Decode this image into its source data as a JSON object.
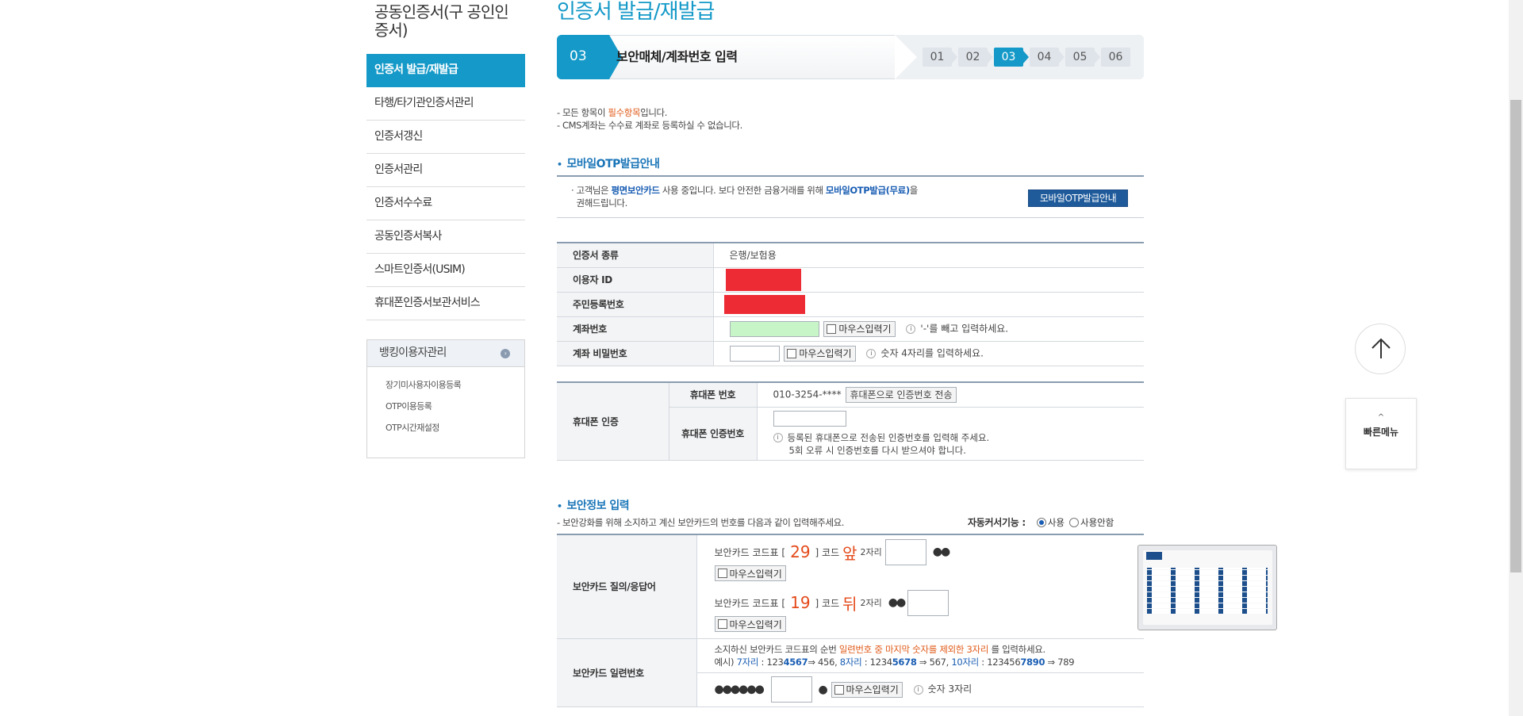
{
  "sidebar": {
    "title": "공동인증서(구 공인인증서)",
    "items": [
      {
        "label": "인증서 발급/재발급",
        "active": true
      },
      {
        "label": "타행/타기관인증서관리"
      },
      {
        "label": "인증서갱신"
      },
      {
        "label": "인증서관리"
      },
      {
        "label": "인증서수수료"
      },
      {
        "label": "공동인증서복사"
      },
      {
        "label": "스마트인증서(USIM)"
      },
      {
        "label": "휴대폰인증서보관서비스"
      }
    ],
    "banking_box": {
      "title": "뱅킹이용자관리",
      "items": [
        "장기미사용자이용등록",
        "OTP이용등록",
        "OTP시간재설정"
      ]
    }
  },
  "main": {
    "page_title": "인증서 발급/재발급",
    "step": {
      "current_num": "03",
      "current_name": "보안매체/계좌번호 입력",
      "steps": [
        "01",
        "02",
        "03",
        "04",
        "05",
        "06"
      ],
      "active_index": 2
    },
    "notes": {
      "line1_a": "- 모든 항목이 ",
      "line1_hl": "필수항목",
      "line1_b": "입니다.",
      "line2": "- CMS계좌는 수수료 계좌로 등록하실 수 없습니다."
    },
    "otp_section": {
      "title": "모바일OTP발급안내",
      "text_a": "· 고객님은 ",
      "text_b1": "평면보안카드",
      "text_c": " 사용 중입니다. 보다 안전한 금융거래를 위해 ",
      "text_b2": "모바일OTP발급(무료)",
      "text_d": "을",
      "text_e": "권해드립니다.",
      "button": "모바일OTP발급안내"
    },
    "cert_table": {
      "rows": [
        {
          "label": "인증서 종류",
          "value": "은행/보험용"
        },
        {
          "label": "이용자 ID"
        },
        {
          "label": "주민등록번호"
        },
        {
          "label": "계좌번호",
          "hint": "'-'를 빼고 입력하세요."
        },
        {
          "label": "계좌 비밀번호",
          "hint": "숫자 4자리를 입력하세요."
        }
      ],
      "mouse_input": "마우스입력기"
    },
    "phone_table": {
      "label": "휴대폰 인증",
      "phone_label": "휴대폰 번호",
      "phone_value": "010-3254-****",
      "send_button": "휴대폰으로 인증번호 전송",
      "code_label": "휴대폰 인증번호",
      "code_hint1": "등록된 휴대폰으로 전송된 인증번호를 입력해 주세요.",
      "code_hint2": "5회 오류 시 인증번호를 다시 받으셔야 합니다."
    },
    "security_section": {
      "title": "보안정보 입력",
      "desc": "- 보안강화를 위해 소지하고 계신 보안카드의 번호를 다음과 같이 입력해주세요.",
      "auto_cursor_label": "자동커서기능 :",
      "auto_on": "사용",
      "auto_off": "사용안함",
      "qa_label": "보안카드 질의/응답어",
      "q1_prefix": "보안카드 코드표 [",
      "q1_code": "29",
      "q1_mid": "] 코드",
      "q1_side": "앞",
      "q1_suffix": "2자리",
      "q2_prefix": "보안카드 코드표 [",
      "q2_code": "19",
      "q2_mid": "] 코드",
      "q2_side": "뒤",
      "q2_suffix": "2자리",
      "dots2": "●●",
      "serial_label": "보안카드 일련번호",
      "serial_text_a": "소지하신 보안카드 코드표의 순번 ",
      "serial_text_hl": "일련번호 중 마지막 숫자를 제외한 3자리",
      "serial_text_b": " 를 입력하세요.",
      "example": "예시) 7자리 : 1234567⇒ 456, 8자리 : 12345678 ⇒ 567, 10자리 : 1234567890 ⇒ 789",
      "ex_prefix": "예시) ",
      "ex1_label": "7자리",
      "ex1_a": " : 123",
      "ex1_b": "4567",
      "ex1_c": "⇒ 456, ",
      "ex2_label": "8자리",
      "ex2_a": " : 1234",
      "ex2_b": "5678",
      "ex2_c": " ⇒ 567, ",
      "ex3_label": "10자리",
      "ex3_a": " : 123456",
      "ex3_b": "7890",
      "ex3_c": " ⇒ 789",
      "dots6": "●●●●●●",
      "dot1": "●",
      "serial_hint": "숫자 3자리"
    }
  },
  "widgets": {
    "quick_menu": "빠른메뉴",
    "quick_chevron": "^"
  }
}
